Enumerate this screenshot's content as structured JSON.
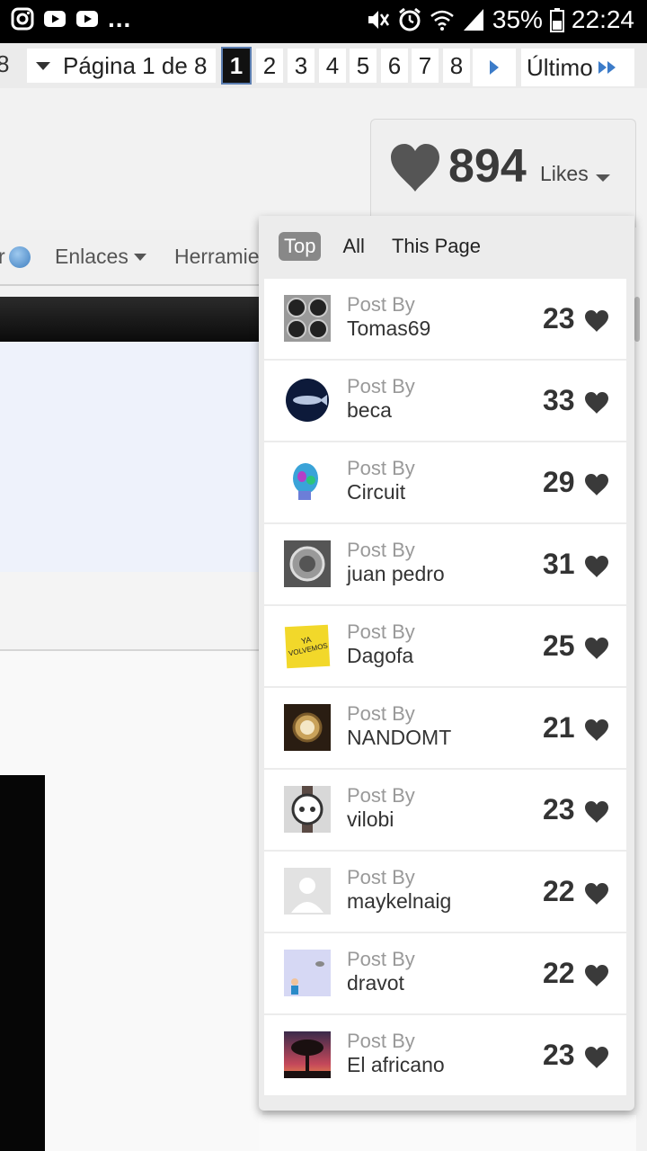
{
  "status_bar": {
    "battery": "35%",
    "time": "22:24",
    "more": "..."
  },
  "pagination": {
    "partial_left": "8",
    "label": "Página 1 de 8",
    "pages": [
      "1",
      "2",
      "3",
      "4",
      "5",
      "6",
      "7",
      "8"
    ],
    "current": "1",
    "last_label": "Último"
  },
  "likes": {
    "count": "894",
    "label": "Likes"
  },
  "nav": {
    "partial_item": "r",
    "links_label": "Enlaces",
    "tools_label": "Herramie"
  },
  "dropdown": {
    "tabs": [
      "Top",
      "All",
      "This Page"
    ],
    "active_tab": "Top",
    "entries": [
      {
        "post_by": "Post By",
        "user": "Tomas69",
        "count": "23"
      },
      {
        "post_by": "Post By",
        "user": "beca",
        "count": "33"
      },
      {
        "post_by": "Post By",
        "user": "Circuit",
        "count": "29"
      },
      {
        "post_by": "Post By",
        "user": "juan pedro",
        "count": "31"
      },
      {
        "post_by": "Post By",
        "user": "Dagofa",
        "count": "25"
      },
      {
        "post_by": "Post By",
        "user": "NANDOMT",
        "count": "21"
      },
      {
        "post_by": "Post By",
        "user": "vilobi",
        "count": "23"
      },
      {
        "post_by": "Post By",
        "user": "maykelnaig",
        "count": "22"
      },
      {
        "post_by": "Post By",
        "user": "dravot",
        "count": "22"
      },
      {
        "post_by": "Post By",
        "user": "El africano",
        "count": "23"
      }
    ],
    "avatar_note_text": "YA VOLVEMOS"
  }
}
